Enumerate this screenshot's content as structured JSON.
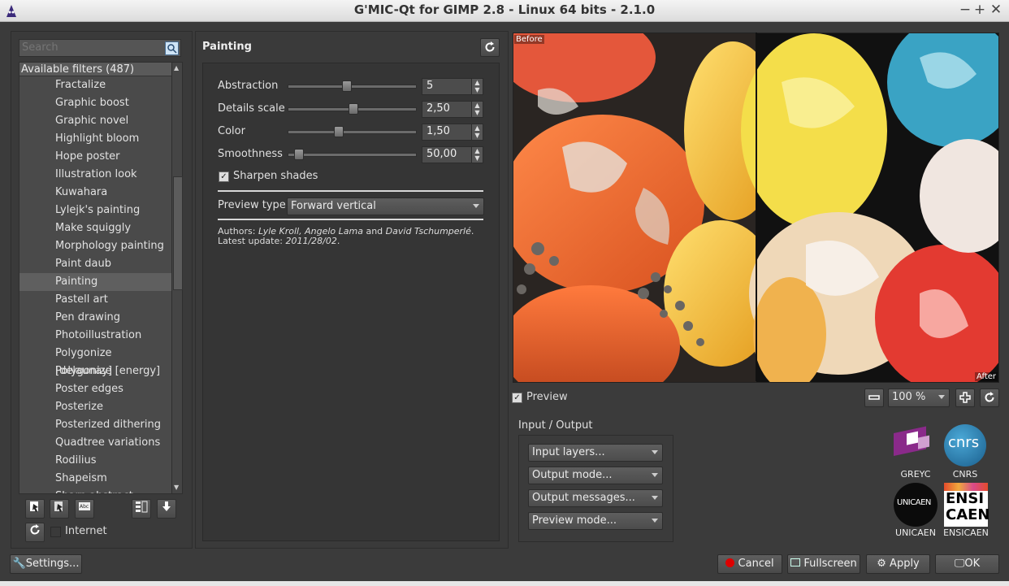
{
  "window": {
    "title": "G'MIC-Qt for GIMP 2.8 - Linux 64 bits - 2.1.0",
    "controls": [
      "−",
      "+",
      "✕"
    ]
  },
  "search": {
    "placeholder": "Search"
  },
  "filters": {
    "header": "Available filters (487)",
    "items": [
      "Fractalize",
      "Graphic boost",
      "Graphic novel",
      "Highlight bloom",
      "Hope poster",
      "Illustration look",
      "Kuwahara",
      "Lylejk's painting",
      "Make squiggly",
      "Morphology painting",
      "Paint daub",
      "Painting",
      "Pastell art",
      "Pen drawing",
      "Photoillustration",
      "Polygonize [delaunay]",
      "Polygonize [energy]",
      "Poster edges",
      "Posterize",
      "Posterized dithering",
      "Quadtree variations",
      "Rodilius",
      "Shapeism",
      "Sharp abstract"
    ],
    "selected": "Painting"
  },
  "left_tools": {
    "internet_label": "Internet"
  },
  "filter": {
    "title": "Painting",
    "params": [
      {
        "label": "Abstraction",
        "value": "5",
        "fraction": 0.45
      },
      {
        "label": "Details scale",
        "value": "2,50",
        "fraction": 0.5
      },
      {
        "label": "Color",
        "value": "1,50",
        "fraction": 0.38
      },
      {
        "label": "Smoothness",
        "value": "50,00",
        "fraction": 0.05
      }
    ],
    "sharpen_label": "Sharpen shades",
    "preview_type_label": "Preview type",
    "preview_type_value": "Forward vertical",
    "authors_prefix": "Authors: ",
    "authors": "Lyle Kroll, Angelo Lama",
    "authors_and": " and ",
    "authors_last": "David Tschumperlé",
    "update_prefix": "Latest update: ",
    "update": "2011/28/02"
  },
  "preview": {
    "before_label": "Before",
    "after_label": "After",
    "checkbox_label": "Preview",
    "zoom": "100 %"
  },
  "io": {
    "title": "Input / Output",
    "combos": [
      "Input layers...",
      "Output mode...",
      "Output messages...",
      "Preview mode..."
    ]
  },
  "logos": {
    "greyc": "GREYC",
    "cnrs": "CNRS",
    "cnrs_mark": "cnrs",
    "unicaen": "UNICAEN",
    "unicaen_mark": "UNICAEN",
    "ensicaen": "ENSICAEN",
    "ensi_top": "ENSI",
    "ensi_bottom": "CAEN"
  },
  "buttons": {
    "settings": "Settings...",
    "cancel": "Cancel",
    "fullscreen": "Fullscreen",
    "apply": "Apply",
    "ok": "OK"
  },
  "colors": {
    "background": "#3b3b3b",
    "accent": "#cc0000"
  }
}
